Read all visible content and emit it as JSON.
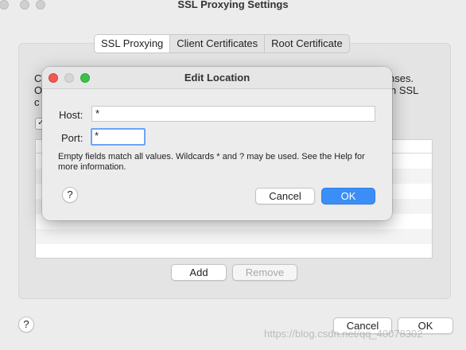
{
  "window": {
    "title": "SSL Proxying Settings",
    "tabs": [
      {
        "label": "SSL Proxying",
        "active": true
      },
      {
        "label": "Client Certificates",
        "active": false
      },
      {
        "label": "Root Certificate",
        "active": false
      }
    ],
    "bg_text": {
      "line1_start": "C",
      "line1_end": "nses.",
      "line2_start": "O",
      "line2_end": "n SSL",
      "line3_start": "c"
    },
    "add_label": "Add",
    "remove_label": "Remove",
    "cancel_label": "Cancel",
    "ok_label": "OK",
    "help_glyph": "?"
  },
  "dialog": {
    "title": "Edit Location",
    "host_label": "Host:",
    "host_value": "*",
    "port_label": "Port:",
    "port_value": "*",
    "note": "Empty fields match all values. Wildcards * and ? may be used. See the Help for more information.",
    "cancel_label": "Cancel",
    "ok_label": "OK",
    "help_glyph": "?"
  },
  "colors": {
    "accent": "#3a8ef6",
    "close": "#ee5a52",
    "minimize": "#d6d6d6",
    "zoom": "#3dbf4a"
  },
  "watermark": "https://blog.csdn.net/qq_40078302"
}
